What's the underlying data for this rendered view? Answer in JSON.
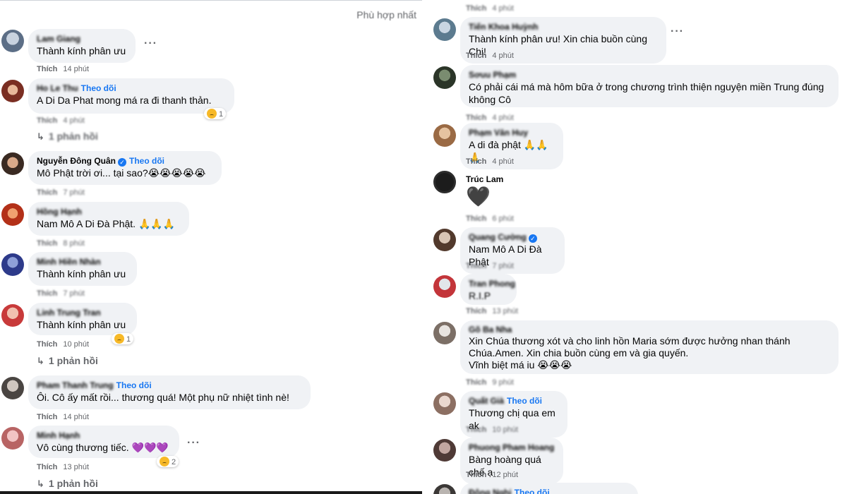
{
  "header": {
    "sort_label": "Phù hợp nhất"
  },
  "left_comments": [
    {
      "name": "Lam Giang",
      "text": "Thành kính phân ưu",
      "like": "Thích",
      "time": "14 phút"
    },
    {
      "name": "Ho Le Thu",
      "follow": "Theo dõi",
      "text": "A Di Da Phat mong má ra đi thanh thản.",
      "like": "Thích",
      "time": "4 phút",
      "reactions": "1",
      "replies": "1 phản hồi"
    },
    {
      "name": "Nguyễn Đông Quân",
      "follow": "Theo dõi",
      "text": "Mô Phật trời ơi... tại sao?😭😭😭😭😭",
      "like": "Thích",
      "time": "7 phút"
    },
    {
      "name": "Hồng Hạnh",
      "text": "Nam Mô A Di Đà Phật. 🙏🙏🙏",
      "like": "Thích",
      "time": "8 phút"
    },
    {
      "name": "Minh Hiền Nhàn",
      "text": "Thành kính phân ưu",
      "like": "Thích",
      "time": "7 phút"
    },
    {
      "name": "Linh Trung Tran",
      "text": "Thành kính phân ưu",
      "like": "Thích",
      "time": "10 phút",
      "reactions": "1",
      "replies": "1 phản hồi"
    },
    {
      "name": "Pham Thanh Trung",
      "follow": "Theo dõi",
      "text": "Ôi. Cô ấy mất rồi... thương quá! Một phụ nữ nhiệt tình nè!",
      "like": "Thích",
      "time": "14 phút"
    },
    {
      "name": "Minh Hạnh",
      "text": "Vô cùng thương tiếc. 💜💜💜",
      "like": "Thích",
      "time": "13 phút",
      "reactions": "2",
      "replies": "1 phản hồi"
    }
  ],
  "right_comments": [
    {
      "like": "Thích",
      "time": "4 phút"
    },
    {
      "name": "Tiến Khoa Huỳnh",
      "text": "Thành kính phân ưu! Xin chia buồn cùng Chị!",
      "like": "Thích",
      "time": "4 phút"
    },
    {
      "name": "Sơuu Phạm",
      "text": "Có phải cái má mà hôm bữa ở trong chương trình thiện nguyện miền Trung đúng không Cô",
      "like": "Thích",
      "time": "4 phút"
    },
    {
      "name": "Phạm Văn Huy",
      "text": "A di đà phật 🙏🙏🙏",
      "like": "Thích",
      "time": "4 phút"
    },
    {
      "name": "Trúc Lam",
      "text": "🖤",
      "like": "Thích",
      "time": "6 phút"
    },
    {
      "name": "Quang Cường",
      "text": "Nam Mô A Di Đà Phật",
      "like": "Thích",
      "time": "7 phút"
    },
    {
      "name": "Tran Phong",
      "text": "R.I.P",
      "like": "Thích",
      "time": "13 phút"
    },
    {
      "name": "Gõ Ba Nha",
      "text": "Xin Chúa thương xót và cho linh hồn Maria sớm được hưởng nhan thánh Chúa.Amen. Xin chia buồn cùng em và gia quyến.",
      "text2": "Vĩnh biệt má iu 😭😭😭",
      "like": "Thích",
      "time": "9 phút"
    },
    {
      "name": "Quất Già",
      "follow": "Theo dõi",
      "text": "Thương chị qua em ak",
      "like": "Thích",
      "time": "10 phút"
    },
    {
      "name": "Phuong Pham Hoang",
      "text": "Bàng hoàng quá chế ạ",
      "like": "Thích",
      "time": "12 phút"
    },
    {
      "name": "Đông Nghi",
      "follow": "Theo dõi"
    }
  ],
  "icons": {
    "more": "more-dots-icon",
    "reply": "reply-arrow-icon",
    "verified": "verified-badge-icon",
    "reaction": "sad-reaction-icon"
  },
  "colors": {
    "bubble": "#f0f2f5",
    "link": "#1877f2",
    "meta": "#65676b"
  }
}
